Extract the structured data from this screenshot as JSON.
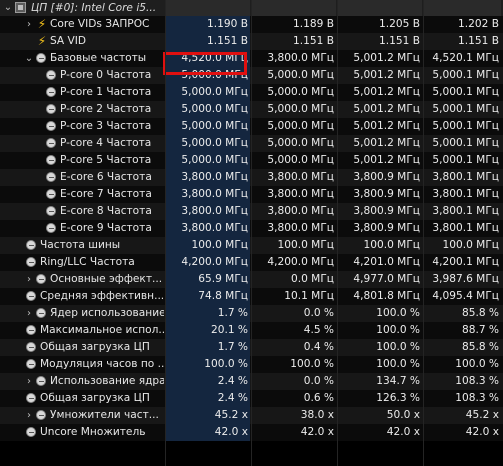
{
  "header": {
    "title": "ЦП [#0]: Intel Core i5..."
  },
  "rows": [
    {
      "chev": "›",
      "icon": "bolt-icon",
      "name": "Core VIDs ЗАПРОС",
      "values": [
        "1.190 В",
        "1.189 В",
        "1.205 В",
        "1.202 В"
      ],
      "indent": 2
    },
    {
      "chev": "",
      "icon": "bolt-icon",
      "name": "SA VID",
      "values": [
        "1.151 В",
        "1.151 В",
        "1.151 В",
        "1.151 В"
      ],
      "indent": 2
    },
    {
      "chev": "⌄",
      "icon": "clock-icon",
      "name": "Базовые частоты",
      "values": [
        "4,520.0 МГц",
        "3,800.0 МГц",
        "5,001.2 МГц",
        "4,520.1 МГц"
      ],
      "indent": 2
    },
    {
      "chev": "",
      "icon": "clock-icon",
      "name": "P-core 0 Частота",
      "values": [
        "5,000.0 МГц",
        "5,000.0 МГц",
        "5,001.2 МГц",
        "5,000.1 МГц"
      ],
      "indent": 3
    },
    {
      "chev": "",
      "icon": "clock-icon",
      "name": "P-core 1 Частота",
      "values": [
        "5,000.0 МГц",
        "5,000.0 МГц",
        "5,001.2 МГц",
        "5,000.1 МГц"
      ],
      "indent": 3
    },
    {
      "chev": "",
      "icon": "clock-icon",
      "name": "P-core 2 Частота",
      "values": [
        "5,000.0 МГц",
        "5,000.0 МГц",
        "5,001.2 МГц",
        "5,000.1 МГц"
      ],
      "indent": 3
    },
    {
      "chev": "",
      "icon": "clock-icon",
      "name": "P-core 3 Частота",
      "values": [
        "5,000.0 МГц",
        "5,000.0 МГц",
        "5,001.2 МГц",
        "5,000.1 МГц"
      ],
      "indent": 3
    },
    {
      "chev": "",
      "icon": "clock-icon",
      "name": "P-core 4 Частота",
      "values": [
        "5,000.0 МГц",
        "5,000.0 МГц",
        "5,001.2 МГц",
        "5,000.1 МГц"
      ],
      "indent": 3
    },
    {
      "chev": "",
      "icon": "clock-icon",
      "name": "P-core 5 Частота",
      "values": [
        "5,000.0 МГц",
        "5,000.0 МГц",
        "5,001.2 МГц",
        "5,000.1 МГц"
      ],
      "indent": 3
    },
    {
      "chev": "",
      "icon": "clock-icon",
      "name": "E-core 6 Частота",
      "values": [
        "3,800.0 МГц",
        "3,800.0 МГц",
        "3,800.9 МГц",
        "3,800.1 МГц"
      ],
      "indent": 3
    },
    {
      "chev": "",
      "icon": "clock-icon",
      "name": "E-core 7 Частота",
      "values": [
        "3,800.0 МГц",
        "3,800.0 МГц",
        "3,800.9 МГц",
        "3,800.1 МГц"
      ],
      "indent": 3
    },
    {
      "chev": "",
      "icon": "clock-icon",
      "name": "E-core 8 Частота",
      "values": [
        "3,800.0 МГц",
        "3,800.0 МГц",
        "3,800.9 МГц",
        "3,800.1 МГц"
      ],
      "indent": 3
    },
    {
      "chev": "",
      "icon": "clock-icon",
      "name": "E-core 9 Частота",
      "values": [
        "3,800.0 МГц",
        "3,800.0 МГц",
        "3,800.9 МГц",
        "3,800.1 МГц"
      ],
      "indent": 3
    },
    {
      "chev": "",
      "icon": "clock-icon",
      "name": "Частота шины",
      "values": [
        "100.0 МГц",
        "100.0 МГц",
        "100.0 МГц",
        "100.0 МГц"
      ],
      "indent": 1
    },
    {
      "chev": "",
      "icon": "clock-icon",
      "name": "Ring/LLC Частота",
      "values": [
        "4,200.0 МГц",
        "4,200.0 МГц",
        "4,201.0 МГц",
        "4,200.1 МГц"
      ],
      "indent": 1
    },
    {
      "chev": "›",
      "icon": "clock-icon",
      "name": "Основные эффект...",
      "values": [
        "65.9 МГц",
        "0.0 МГц",
        "4,977.0 МГц",
        "3,987.6 МГц"
      ],
      "indent": 2
    },
    {
      "chev": "",
      "icon": "clock-icon",
      "name": "Средняя эффективн...",
      "values": [
        "74.8 МГц",
        "10.1 МГц",
        "4,801.8 МГц",
        "4,095.4 МГц"
      ],
      "indent": 1
    },
    {
      "chev": "›",
      "icon": "clock-icon",
      "name": "Ядер использование",
      "values": [
        "1.7 %",
        "0.0 %",
        "100.0 %",
        "85.8 %"
      ],
      "indent": 2
    },
    {
      "chev": "",
      "icon": "clock-icon",
      "name": "Максимальное испол...",
      "values": [
        "20.1 %",
        "4.5 %",
        "100.0 %",
        "88.7 %"
      ],
      "indent": 1
    },
    {
      "chev": "",
      "icon": "clock-icon",
      "name": "Общая загрузка ЦП",
      "values": [
        "1.7 %",
        "0.4 %",
        "100.0 %",
        "85.8 %"
      ],
      "indent": 1
    },
    {
      "chev": "",
      "icon": "clock-icon",
      "name": "Модуляция часов по ...",
      "values": [
        "100.0 %",
        "100.0 %",
        "100.0 %",
        "100.0 %"
      ],
      "indent": 1
    },
    {
      "chev": "›",
      "icon": "clock-icon",
      "name": "Использование ядра",
      "values": [
        "2.4 %",
        "0.0 %",
        "134.7 %",
        "108.3 %"
      ],
      "indent": 2
    },
    {
      "chev": "",
      "icon": "clock-icon",
      "name": "Общая загрузка ЦП",
      "values": [
        "2.4 %",
        "0.6 %",
        "126.3 %",
        "108.3 %"
      ],
      "indent": 1
    },
    {
      "chev": "›",
      "icon": "clock-icon",
      "name": "Умножители част...",
      "values": [
        "45.2 x",
        "38.0 x",
        "50.0 x",
        "45.2 x"
      ],
      "indent": 2
    },
    {
      "chev": "",
      "icon": "clock-icon",
      "name": "Uncore Множитель",
      "values": [
        "42.0 x",
        "42.0 x",
        "42.0 x",
        "42.0 x"
      ],
      "indent": 1
    }
  ],
  "colors": {
    "highlight_column": "#14263f",
    "annotation_box": "#e01010",
    "bolt": "#f4c21b"
  }
}
